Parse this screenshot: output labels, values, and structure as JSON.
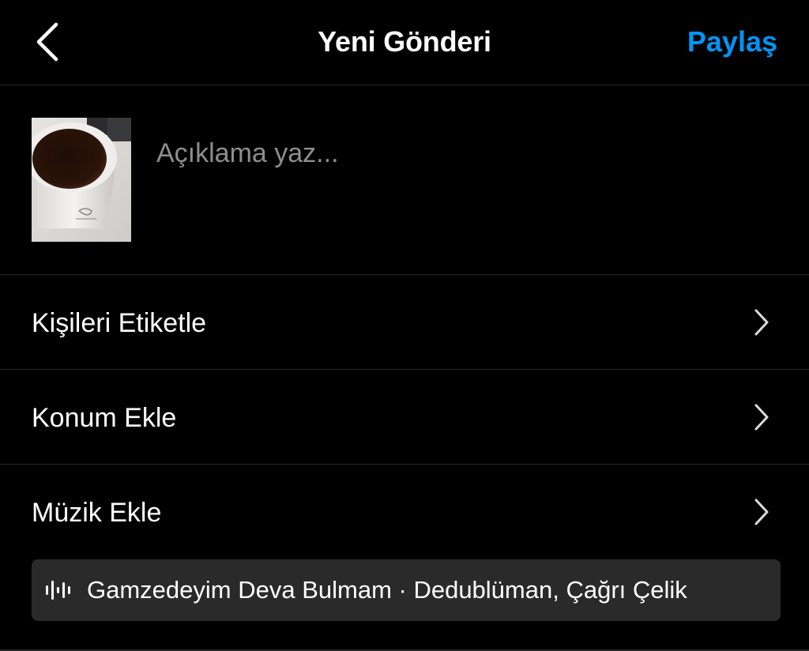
{
  "header": {
    "back_icon": "chevron-left-icon",
    "title": "Yeni Gönderi",
    "share_label": "Paylaş",
    "share_color": "#0095f6"
  },
  "compose": {
    "thumbnail": "coffee-cup-photo",
    "caption_placeholder": "Açıklama yaz...",
    "caption_value": ""
  },
  "options": [
    {
      "label": "Kişileri Etiketle",
      "icon": "chevron-right-icon"
    },
    {
      "label": "Konum Ekle",
      "icon": "chevron-right-icon"
    },
    {
      "label": "Müzik Ekle",
      "icon": "chevron-right-icon"
    }
  ],
  "music": {
    "icon": "audio-wave-icon",
    "track": "Gamzedeyim Deva Bulmam · Dedublüman, Çağrı Çelik"
  },
  "colors": {
    "background": "#000000",
    "divider": "#262626",
    "text": "#ffffff",
    "placeholder": "#8e8e8e",
    "pill": "#2a2a2a"
  }
}
